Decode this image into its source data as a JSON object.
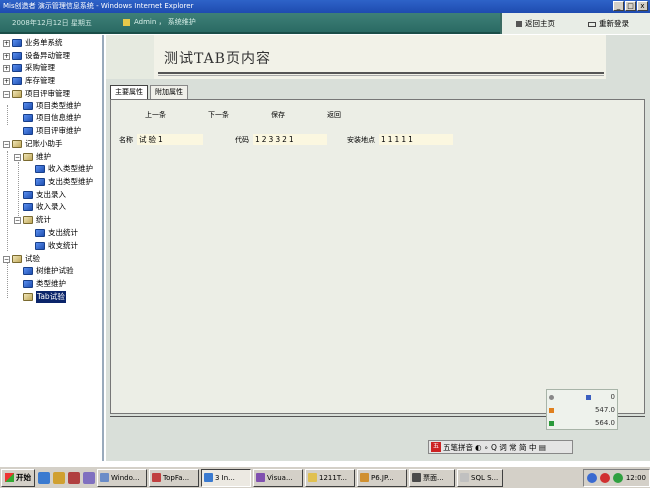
{
  "window": {
    "title": "Mis创造者  演示管理信息系统 - Windows Internet Explorer",
    "min": "_",
    "max": "□",
    "close": "x"
  },
  "header": {
    "date": "2008年12月12日 星期五",
    "user": "Admin ， 系统维护",
    "home_link": "返回主页",
    "relogin_link": "重新登录"
  },
  "tree": {
    "items": [
      {
        "label": "业务单系统",
        "expander": "+"
      },
      {
        "label": "设备异动管理",
        "expander": "+"
      },
      {
        "label": "采购管理",
        "expander": "+"
      },
      {
        "label": "库存管理",
        "expander": "+"
      },
      {
        "label": "项目评审管理",
        "expander": "−"
      },
      {
        "label": "项目类型维护"
      },
      {
        "label": "项目信息维护"
      },
      {
        "label": "项目评审维护"
      },
      {
        "label": "记账小助手",
        "expander": "−"
      },
      {
        "label": "维护",
        "expander": "−"
      },
      {
        "label": "收入类型维护"
      },
      {
        "label": "支出类型维护"
      },
      {
        "label": "支出录入"
      },
      {
        "label": "收入录入"
      },
      {
        "label": "统计",
        "expander": "−"
      },
      {
        "label": "支出统计"
      },
      {
        "label": "收支统计"
      },
      {
        "label": "试验",
        "expander": "−"
      },
      {
        "label": "树维护试验"
      },
      {
        "label": "类型维护"
      },
      {
        "label": "Tab试验"
      }
    ]
  },
  "main": {
    "page_title": "测试TAB页内容",
    "tabs": [
      {
        "label": "主要属性"
      },
      {
        "label": "附加属性"
      }
    ],
    "actions": {
      "prev": "上一条",
      "next": "下一条",
      "save": "保存",
      "back": "返回"
    },
    "form": {
      "name_label": "名称",
      "name_value": "试验1",
      "code_label": "代码",
      "code_value": "123321",
      "location_label": "安装地点",
      "location_value": "11111"
    }
  },
  "stats": {
    "row1": "0",
    "row2": "547.0",
    "row3": "564.0"
  },
  "ime": {
    "label": "五笔拼音",
    "extra": "◐ ∘ Q 词 常 简 中 ▤"
  },
  "taskbar": {
    "start": "开始",
    "items": [
      {
        "label": "Windo..."
      },
      {
        "label": "TopFa..."
      },
      {
        "label": "3 In..."
      },
      {
        "label": "Visua..."
      },
      {
        "label": "1211T..."
      },
      {
        "label": "P6.JP..."
      },
      {
        "label": "票面..."
      },
      {
        "label": "SQL S..."
      }
    ],
    "clock": "12:00"
  }
}
